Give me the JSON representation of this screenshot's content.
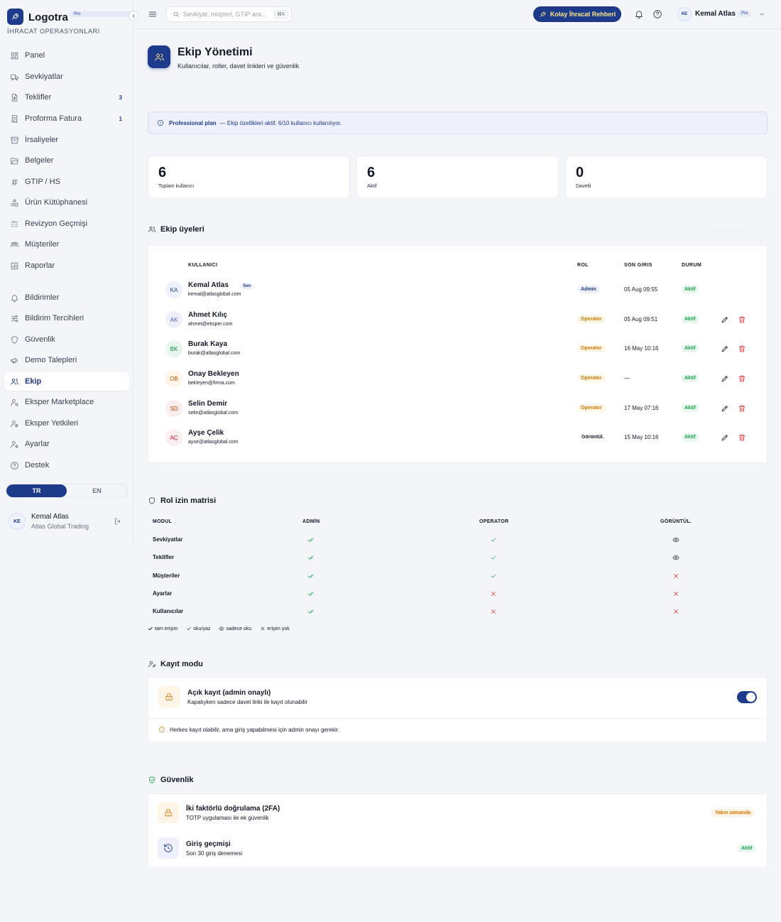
{
  "brand": {
    "name": "Logotra",
    "badge": "Pro",
    "subtitle": "İHRACAT OPERASYONLARI"
  },
  "sidebar": {
    "items": [
      {
        "label": "Panel",
        "icon": "grid-icon",
        "badge": ""
      },
      {
        "label": "Sevkiyatlar",
        "icon": "truck-icon",
        "badge": ""
      },
      {
        "label": "Teklifler",
        "icon": "file-dollar-icon",
        "badge": "3"
      },
      {
        "label": "Proforma Fatura",
        "icon": "receipt-icon",
        "badge": "1"
      },
      {
        "label": "İrsaliyeler",
        "icon": "archive-icon",
        "badge": ""
      },
      {
        "label": "Belgeler",
        "icon": "folder-icon",
        "badge": ""
      },
      {
        "label": "GTIP / HS",
        "icon": "hash-icon",
        "badge": ""
      },
      {
        "label": "Ürün Kütüphanesi",
        "icon": "shapes-icon",
        "badge": ""
      },
      {
        "label": "Revizyon Geçmişi",
        "icon": "history-icon",
        "badge": ""
      },
      {
        "label": "Müşteriler",
        "icon": "users-icon",
        "badge": ""
      },
      {
        "label": "Raporlar",
        "icon": "chart-icon",
        "badge": ""
      },
      {
        "label": "Bildirimler",
        "icon": "bell-icon",
        "badge": ""
      },
      {
        "label": "Bildirim Tercihleri",
        "icon": "sliders-icon",
        "badge": ""
      },
      {
        "label": "Güvenlik",
        "icon": "shield-icon",
        "badge": ""
      },
      {
        "label": "Demo Talepleri",
        "icon": "megaphone-icon",
        "badge": ""
      },
      {
        "label": "Ekip",
        "icon": "team-icon",
        "badge": ""
      },
      {
        "label": "Eksper Marketplace",
        "icon": "user-search-icon",
        "badge": ""
      },
      {
        "label": "Eksper Yetkileri",
        "icon": "user-key-icon",
        "badge": ""
      },
      {
        "label": "Ayarlar",
        "icon": "user-gear-icon",
        "badge": ""
      },
      {
        "label": "Destek",
        "icon": "help-icon",
        "badge": ""
      }
    ],
    "active": "Ekip",
    "lang": {
      "tr": "TR",
      "en": "EN",
      "selected": "TR"
    },
    "user": {
      "initials": "KE",
      "name": "Kemal Atlas",
      "org": "Atlas Global Trading"
    }
  },
  "topbar": {
    "search_placeholder": "Sevkiyat, müşteri, GTIP ara...",
    "shortcut": "⌘K",
    "guide_button": "Kolay İhracat Rehberi",
    "user_initials": "KE",
    "user_name": "Kemal Atlas",
    "user_badge": "Pro"
  },
  "page": {
    "title": "Ekip Yönetimi",
    "subtitle": "Kullanıcılar, roller, davet linkleri ve güvenlik"
  },
  "plan": {
    "name": "Professional plan",
    "text": "— Ekip özellikleri aktif. 6/10 kullanıcı kullanılıyor."
  },
  "stats": [
    {
      "value": "6",
      "label": "Toplam kullanıcı"
    },
    {
      "value": "6",
      "label": "Aktif"
    },
    {
      "value": "0",
      "label": "Davetli"
    }
  ],
  "members": {
    "title": "Ekip üyeleri",
    "invite_label": "Davet gönder",
    "columns": {
      "user": "KULLANICI",
      "role": "ROL",
      "last": "SON GIRIS",
      "status": "DURUM"
    },
    "rows": [
      {
        "initials": "KA",
        "name": "Kemal Atlas",
        "you": "Sen",
        "email": "kemal@atlasglobal.com",
        "role": "Admin",
        "role_kind": "admin",
        "last": "05 Aug 09:55",
        "status": "Aktif",
        "actions": false,
        "avatar_bg": "#eef2ff",
        "avatar_fg": "#1e3a8a"
      },
      {
        "initials": "AK",
        "name": "Ahmet Kılıç",
        "you": "",
        "email": "ahmet@eksper.com",
        "role": "Operator",
        "role_kind": "op",
        "last": "05 Aug 09:51",
        "status": "Aktif",
        "actions": true,
        "avatar_bg": "#eef0fb",
        "avatar_fg": "#4f5db8"
      },
      {
        "initials": "BK",
        "name": "Burak Kaya",
        "you": "",
        "email": "burak@atlasglobal.com",
        "role": "Operator",
        "role_kind": "op",
        "last": "16 May 10:16",
        "status": "Aktif",
        "actions": true,
        "avatar_bg": "#e8f7ee",
        "avatar_fg": "#15803d"
      },
      {
        "initials": "OB",
        "name": "Onay Bekleyen",
        "you": "",
        "email": "bekleyen@firma.com",
        "role": "Operator",
        "role_kind": "op",
        "last": "—",
        "status": "Aktif",
        "actions": true,
        "avatar_bg": "#fef5e6",
        "avatar_fg": "#b45309"
      },
      {
        "initials": "SD",
        "name": "Selin Demir",
        "you": "",
        "email": "selin@atlasglobal.com",
        "role": "Operator",
        "role_kind": "op",
        "last": "17 May 07:16",
        "status": "Aktif",
        "actions": true,
        "avatar_bg": "#fdeeee",
        "avatar_fg": "#c2410c"
      },
      {
        "initials": "AÇ",
        "name": "Ayşe Çelik",
        "you": "",
        "email": "ayse@atlasglobal.com",
        "role": "Görüntül.",
        "role_kind": "view",
        "last": "15 May 10:16",
        "status": "Aktif",
        "actions": true,
        "avatar_bg": "#fdeef0",
        "avatar_fg": "#be123c"
      }
    ]
  },
  "matrix": {
    "title": "Rol izin matrisi",
    "headers": [
      "MODUL",
      "ADMİN",
      "OPERATOR",
      "GÖRÜNTÜL."
    ],
    "rows": [
      {
        "module": "Sevkiyatlar",
        "cells": [
          "full",
          "rw",
          "ro"
        ]
      },
      {
        "module": "Teklifler",
        "cells": [
          "full",
          "rw",
          "ro"
        ]
      },
      {
        "module": "Müşteriler",
        "cells": [
          "full",
          "rw",
          "no"
        ]
      },
      {
        "module": "Ayarlar",
        "cells": [
          "full",
          "no",
          "no"
        ]
      },
      {
        "module": "Kullanıcılar",
        "cells": [
          "full",
          "no",
          "no"
        ]
      }
    ],
    "legend": {
      "full": "tam erişim",
      "rw": "oku/yaz",
      "ro": "sadece oku",
      "no": "erişim yok"
    }
  },
  "registration": {
    "title": "Kayıt modu",
    "option_title": "Açık kayıt (admin onaylı)",
    "option_sub": "Kapalıyken sadece davet linki ile kayıt olunabilir",
    "enabled": true,
    "note": "Herkes kayıt olabilir, ama giriş yapabilmesi için admin onayı gerekir."
  },
  "security": {
    "title": "Güvenlik",
    "items": [
      {
        "title": "İki faktörlü doğrulama (2FA)",
        "sub": "TOTP uygulaması ile ek güvenlik",
        "badge": "Yakın zamanda",
        "kind": "soon"
      },
      {
        "title": "Giriş geçmişi",
        "sub": "Son 30 giriş denemesi",
        "badge": "Aktif",
        "kind": "ok"
      }
    ]
  },
  "colors": {
    "primary": "#1e3a8a",
    "accent": "#fde68a",
    "success": "#16a34a",
    "warning": "#d97706",
    "danger": "#dc2626"
  }
}
